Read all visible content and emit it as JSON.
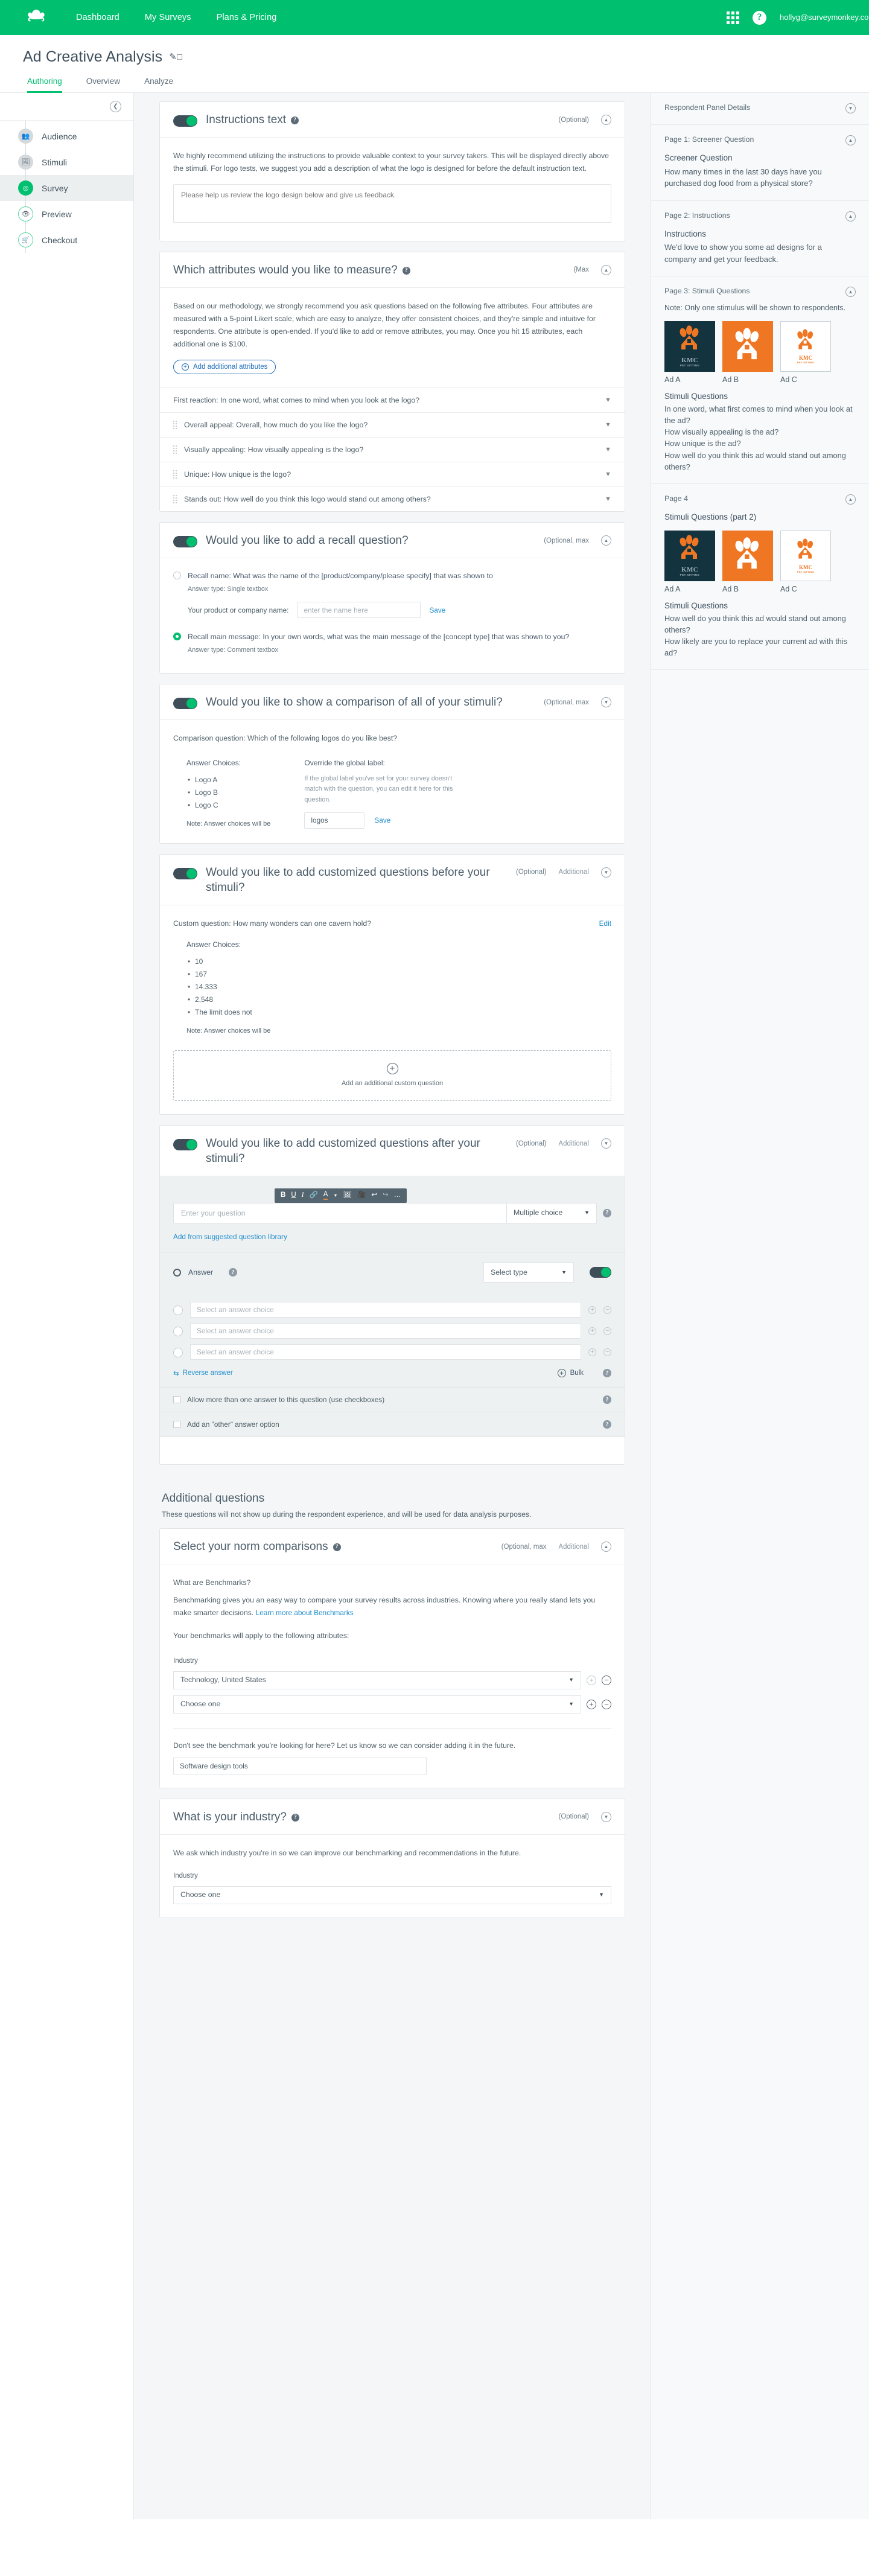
{
  "topnav": {
    "links": [
      "Dashboard",
      "My Surveys",
      "Plans & Pricing"
    ],
    "account": "hollyg@surveymonkey.com",
    "brand_color": "#00bf6f"
  },
  "page": {
    "title": "Ad Creative Analysis",
    "tabs": [
      {
        "label": "Authoring",
        "active": true
      },
      {
        "label": "Overview",
        "active": false
      },
      {
        "label": "Analyze",
        "active": false
      }
    ]
  },
  "sidebar": {
    "items": [
      {
        "label": "Audience",
        "icon": "people-icon",
        "state": "done"
      },
      {
        "label": "Stimuli",
        "icon": "image-icon",
        "state": "done"
      },
      {
        "label": "Survey",
        "icon": "target-icon",
        "state": "active"
      },
      {
        "label": "Preview",
        "icon": "eye-icon",
        "state": "pending"
      },
      {
        "label": "Checkout",
        "icon": "cart-icon",
        "state": "pending"
      }
    ]
  },
  "cards": {
    "instructions": {
      "title": "Instructions text",
      "meta": "(Optional)",
      "body": "We highly recommend utilizing the instructions to provide valuable context to your survey takers. This will be displayed directly above the stimuli. For logo tests, we suggest you add a description of what the logo is designed for before the default instruction text.",
      "placeholder": "Please help us review the logo design below and give us feedback."
    },
    "attributes": {
      "title": "Which attributes would you like to measure?",
      "meta": "(Max",
      "body": "Based on our methodology, we strongly recommend you ask questions based on the following five attributes. Four attributes are measured with a 5-point Likert scale, which are easy to analyze, they offer consistent choices, and they're simple and intuitive for respondents. One attribute is open-ended. If you'd like to add or remove attributes, you may. Once you hit 15 attributes, each additional one is $100.",
      "add_button": "Add additional attributes",
      "rows": [
        {
          "label": "First reaction: In one word, what comes to mind when you look at the logo?",
          "draggable": false
        },
        {
          "label": "Overall appeal: Overall, how much do you like the logo?",
          "draggable": true
        },
        {
          "label": "Visually appealing: How visually appealing is the logo?",
          "draggable": true
        },
        {
          "label": "Unique: How unique is the logo?",
          "draggable": true
        },
        {
          "label": "Stands out: How well do you think this logo would stand out among others?",
          "draggable": true
        }
      ]
    },
    "recall": {
      "title": "Would you like to add a recall question?",
      "meta": "(Optional, max",
      "option1": {
        "title": "Recall name: What was the name of the [product/company/please specify] that was shown to",
        "sub": "Answer type: Single textbox",
        "field_label": "Your product or company name:",
        "field_placeholder": "enter the name here",
        "save": "Save",
        "selected": false
      },
      "option2": {
        "title": "Recall main message: In your own words, what was the main message of the [concept type] that was shown to you?",
        "sub": "Answer type: Comment textbox",
        "selected": true
      }
    },
    "comparison": {
      "title": "Would you like to show a comparison of all of your stimuli?",
      "meta": "(Optional, max",
      "question": "Comparison question: Which of the following logos do you like best?",
      "choices_header": "Answer Choices:",
      "choices": [
        "Logo A",
        "Logo B",
        "Logo C"
      ],
      "note": "Note: Answer choices will be",
      "override_header": "Override the global label:",
      "override_desc": "If the global label you've set for your survey doesn't match with the question, you can edit it here for this question.",
      "override_value": "logos",
      "save": "Save"
    },
    "custom_before": {
      "title": "Would you like to add customized questions before your stimuli?",
      "meta": "(Optional)",
      "meta2": "Additional",
      "question": "Custom question: How many wonders can one cavern hold?",
      "edit": "Edit",
      "choices_header": "Answer Choices:",
      "choices": [
        "10",
        "167",
        "14.333",
        "2,548",
        "The limit does not"
      ],
      "note": "Note: Answer choices will be",
      "add_box": "Add an additional custom question"
    },
    "custom_after": {
      "title": "Would you like to add customized questions after your stimuli?",
      "meta": "(Optional)",
      "meta2": "Additional",
      "toolbar_icons": [
        "B",
        "U",
        "I",
        "link-icon",
        "A",
        "caret-icon",
        "image-icon",
        "video-icon",
        "undo-icon",
        "redo-icon",
        "more-icon"
      ],
      "question_placeholder": "Enter your question",
      "question_type": "Multiple choice",
      "library_link": "Add from suggested question library",
      "answer_label": "Answer",
      "answer_type": "Select type",
      "choice_placeholder": "Select an answer choice",
      "choice_count": 3,
      "reverse_label": "Reverse answer",
      "bulk_label": "Bulk",
      "checkbox1": "Allow more than one answer to this question (use checkboxes)",
      "checkbox2": "Add an \"other\" answer option"
    },
    "additional_section": {
      "heading": "Additional questions",
      "desc": "These questions will not show up during the respondent experience, and will be used for data analysis purposes."
    },
    "norms": {
      "title": "Select your norm comparisons",
      "meta": "(Optional, max",
      "meta2": "Additional",
      "q1": "What are Benchmarks?",
      "p1": "Benchmarking gives you an easy way to compare your survey results across industries. Knowing where you really stand lets you make smarter decisions.",
      "link1": "Learn more about Benchmarks",
      "p2": "Your benchmarks will apply to the following attributes:",
      "industry_label": "Industry",
      "select1": "Technology, United States",
      "select2": "Choose one",
      "footer_text": "Don't see the benchmark you're looking for here? Let us know so we can consider adding it in the future.",
      "footer_value": "Software design tools"
    },
    "industry": {
      "title": "What is your industry?",
      "meta": "(Optional)",
      "body": "We ask which industry you're in so we can improve our benchmarking and recommendations in the future.",
      "field_label": "Industry",
      "select": "Choose one"
    }
  },
  "rightpanel": {
    "respondent_panel": "Respondent Panel Details",
    "blocks": [
      {
        "page_label": "Page 1: Screener Question",
        "title": "Screener Question",
        "text": "How many times in the last 30 days have you purchased dog food from a physical store?"
      },
      {
        "page_label": "Page 2: Instructions",
        "title": "Instructions",
        "text": "We'd love to show you some ad designs for a company and get your feedback."
      }
    ],
    "stimuli_page3": {
      "page_label": "Page 3: Stimuli Questions",
      "note": "Note: Only one stimulus will be shown to respondents.",
      "thumbs": [
        {
          "caption": "Ad A",
          "style": "dark"
        },
        {
          "caption": "Ad B",
          "style": "orange"
        },
        {
          "caption": "Ad C",
          "style": "white"
        }
      ],
      "questions_title": "Stimuli Questions",
      "questions": [
        "In one word, what first comes to mind when you look at the ad?",
        "How visually appealing is the ad?",
        "How unique is the ad?",
        "How well do you think this ad would stand out among others?"
      ]
    },
    "stimuli_page4": {
      "page_label": "Page 4",
      "title": "Stimuli Questions (part 2)",
      "thumbs": [
        {
          "caption": "Ad A",
          "style": "dark"
        },
        {
          "caption": "Ad B",
          "style": "orange"
        },
        {
          "caption": "Ad C",
          "style": "white"
        }
      ],
      "questions_title": "Stimuli Questions",
      "questions": [
        "How well do you think this ad would stand out among others?",
        "How likely are you to replace your current ad with this ad?"
      ]
    },
    "logo_text": {
      "brand": "KMC",
      "tagline": "PET SITTING"
    }
  }
}
